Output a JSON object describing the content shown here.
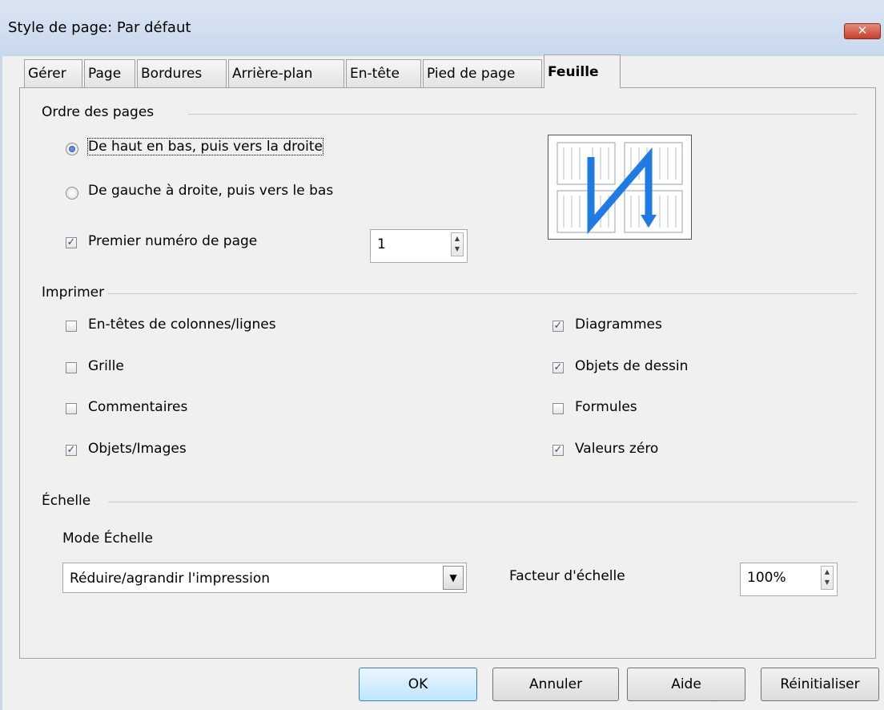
{
  "window": {
    "title": "Style de page: Par défaut",
    "close_glyph": "✕"
  },
  "tabs": [
    {
      "label": "Gérer"
    },
    {
      "label": "Page"
    },
    {
      "label": "Bordures"
    },
    {
      "label": "Arrière-plan"
    },
    {
      "label": "En-tête"
    },
    {
      "label": "Pied de page"
    },
    {
      "label": "Feuille",
      "active": true
    }
  ],
  "page_order": {
    "section_label": "Ordre des pages",
    "options": [
      {
        "label": "De haut en bas, puis vers la droite",
        "selected": true
      },
      {
        "label": "De gauche à droite, puis vers le bas",
        "selected": false
      }
    ],
    "first_page": {
      "label": "Premier numéro de page",
      "checked": true,
      "value": "1"
    }
  },
  "print": {
    "section_label": "Imprimer",
    "left": [
      {
        "label": "En-têtes de colonnes/lignes",
        "checked": false
      },
      {
        "label": "Grille",
        "checked": false
      },
      {
        "label": "Commentaires",
        "checked": false
      },
      {
        "label": "Objets/Images",
        "checked": true
      }
    ],
    "right": [
      {
        "label": "Diagrammes",
        "checked": true
      },
      {
        "label": "Objets de dessin",
        "checked": true
      },
      {
        "label": "Formules",
        "checked": false
      },
      {
        "label": "Valeurs zéro",
        "checked": true
      }
    ]
  },
  "scale": {
    "section_label": "Échelle",
    "mode_label": "Mode Échelle",
    "mode_value": "Réduire/agrandir l'impression",
    "factor_label": "Facteur d'échelle",
    "factor_value": "100%"
  },
  "buttons": {
    "ok": "OK",
    "cancel": "Annuler",
    "help": "Aide",
    "reset": "Réinitialiser"
  },
  "colors": {
    "accent": "#3c7fb1",
    "preview_arrow": "#1e7be6"
  },
  "check_glyph": "✓"
}
